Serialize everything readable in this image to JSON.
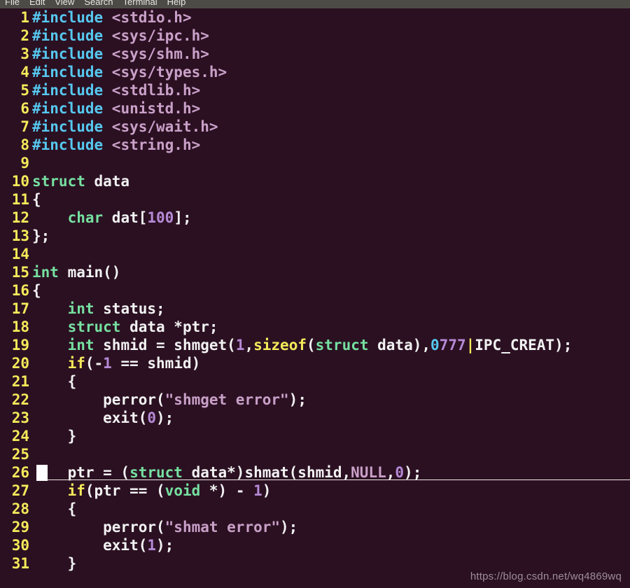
{
  "window": {
    "title": "Terminal",
    "background_color": "#2b1022",
    "menubar_color": "#4d4b45"
  },
  "menubar": {
    "items": [
      {
        "label": "File"
      },
      {
        "label": "Edit"
      },
      {
        "label": "View"
      },
      {
        "label": "Search"
      },
      {
        "label": "Terminal"
      },
      {
        "label": "Help"
      }
    ]
  },
  "editor": {
    "cursor_line": 26,
    "colors": {
      "line_number": "#f5ea5a",
      "preprocessor": "#56c8ef",
      "header": "#c9a0c8",
      "type_keyword": "#76e0a0",
      "keyword": "#f5ea5a",
      "number": "#b58ad6",
      "string": "#c9a0c8",
      "plain": "#f2f2f2",
      "cursor": "#ffffff"
    },
    "lines": [
      {
        "n": "1",
        "tokens": [
          {
            "t": "#include ",
            "c": "pre"
          },
          {
            "t": "<stdio.h>",
            "c": "header"
          }
        ]
      },
      {
        "n": "2",
        "tokens": [
          {
            "t": "#include ",
            "c": "pre"
          },
          {
            "t": "<sys/ipc.h>",
            "c": "header"
          }
        ]
      },
      {
        "n": "3",
        "tokens": [
          {
            "t": "#include ",
            "c": "pre"
          },
          {
            "t": "<sys/shm.h>",
            "c": "header"
          }
        ]
      },
      {
        "n": "4",
        "tokens": [
          {
            "t": "#include ",
            "c": "pre"
          },
          {
            "t": "<sys/types.h>",
            "c": "header"
          }
        ]
      },
      {
        "n": "5",
        "tokens": [
          {
            "t": "#include ",
            "c": "pre"
          },
          {
            "t": "<stdlib.h>",
            "c": "header"
          }
        ]
      },
      {
        "n": "6",
        "tokens": [
          {
            "t": "#include ",
            "c": "pre"
          },
          {
            "t": "<unistd.h>",
            "c": "header"
          }
        ]
      },
      {
        "n": "7",
        "tokens": [
          {
            "t": "#include ",
            "c": "pre"
          },
          {
            "t": "<sys/wait.h>",
            "c": "header"
          }
        ]
      },
      {
        "n": "8",
        "tokens": [
          {
            "t": "#include ",
            "c": "pre"
          },
          {
            "t": "<string.h>",
            "c": "header"
          }
        ]
      },
      {
        "n": "9",
        "tokens": []
      },
      {
        "n": "10",
        "tokens": [
          {
            "t": "struct",
            "c": "type"
          },
          {
            "t": " data",
            "c": "plain"
          }
        ]
      },
      {
        "n": "11",
        "tokens": [
          {
            "t": "{",
            "c": "plain"
          }
        ]
      },
      {
        "n": "12",
        "tokens": [
          {
            "t": "    ",
            "c": "plain"
          },
          {
            "t": "char",
            "c": "type"
          },
          {
            "t": " dat[",
            "c": "plain"
          },
          {
            "t": "100",
            "c": "num"
          },
          {
            "t": "];",
            "c": "plain"
          }
        ]
      },
      {
        "n": "13",
        "tokens": [
          {
            "t": "};",
            "c": "plain"
          }
        ]
      },
      {
        "n": "14",
        "tokens": []
      },
      {
        "n": "15",
        "tokens": [
          {
            "t": "int",
            "c": "type"
          },
          {
            "t": " main()",
            "c": "plain"
          }
        ]
      },
      {
        "n": "16",
        "tokens": [
          {
            "t": "{",
            "c": "plain"
          }
        ]
      },
      {
        "n": "17",
        "tokens": [
          {
            "t": "    ",
            "c": "plain"
          },
          {
            "t": "int",
            "c": "type"
          },
          {
            "t": " status;",
            "c": "plain"
          }
        ]
      },
      {
        "n": "18",
        "tokens": [
          {
            "t": "    ",
            "c": "plain"
          },
          {
            "t": "struct",
            "c": "type"
          },
          {
            "t": " data *ptr;",
            "c": "plain"
          }
        ]
      },
      {
        "n": "19",
        "tokens": [
          {
            "t": "    ",
            "c": "plain"
          },
          {
            "t": "int",
            "c": "type"
          },
          {
            "t": " shmid = shmget(",
            "c": "plain"
          },
          {
            "t": "1",
            "c": "num"
          },
          {
            "t": ",",
            "c": "plain"
          },
          {
            "t": "sizeof",
            "c": "kw"
          },
          {
            "t": "(",
            "c": "plain"
          },
          {
            "t": "struct",
            "c": "type"
          },
          {
            "t": " data),",
            "c": "plain"
          },
          {
            "t": "0",
            "c": "num2"
          },
          {
            "t": "777",
            "c": "num"
          },
          {
            "t": "|",
            "c": "kw"
          },
          {
            "t": "IPC_CREAT);",
            "c": "plain"
          }
        ]
      },
      {
        "n": "20",
        "tokens": [
          {
            "t": "    ",
            "c": "plain"
          },
          {
            "t": "if",
            "c": "kw"
          },
          {
            "t": "(-",
            "c": "plain"
          },
          {
            "t": "1",
            "c": "num"
          },
          {
            "t": " == shmid)",
            "c": "plain"
          }
        ]
      },
      {
        "n": "21",
        "tokens": [
          {
            "t": "    {",
            "c": "plain"
          }
        ]
      },
      {
        "n": "22",
        "tokens": [
          {
            "t": "        perror(",
            "c": "plain"
          },
          {
            "t": "\"shmget error\"",
            "c": "str"
          },
          {
            "t": ");",
            "c": "plain"
          }
        ]
      },
      {
        "n": "23",
        "tokens": [
          {
            "t": "        exit(",
            "c": "plain"
          },
          {
            "t": "0",
            "c": "num"
          },
          {
            "t": ");",
            "c": "plain"
          }
        ]
      },
      {
        "n": "24",
        "tokens": [
          {
            "t": "    }",
            "c": "plain"
          }
        ]
      },
      {
        "n": "25",
        "tokens": []
      },
      {
        "n": "26",
        "tokens": [
          {
            "t": "    ptr = (",
            "c": "plain"
          },
          {
            "t": "struct",
            "c": "type"
          },
          {
            "t": " data*)shmat(shmid,",
            "c": "plain"
          },
          {
            "t": "NULL",
            "c": "const"
          },
          {
            "t": ",",
            "c": "plain"
          },
          {
            "t": "0",
            "c": "num"
          },
          {
            "t": ");",
            "c": "plain"
          }
        ],
        "current": true
      },
      {
        "n": "27",
        "tokens": [
          {
            "t": "    ",
            "c": "plain"
          },
          {
            "t": "if",
            "c": "kw"
          },
          {
            "t": "(ptr == (",
            "c": "plain"
          },
          {
            "t": "void",
            "c": "type"
          },
          {
            "t": " *) - ",
            "c": "plain"
          },
          {
            "t": "1",
            "c": "num"
          },
          {
            "t": ")",
            "c": "plain"
          }
        ]
      },
      {
        "n": "28",
        "tokens": [
          {
            "t": "    {",
            "c": "plain"
          }
        ]
      },
      {
        "n": "29",
        "tokens": [
          {
            "t": "        perror(",
            "c": "plain"
          },
          {
            "t": "\"shmat error\"",
            "c": "str"
          },
          {
            "t": ");",
            "c": "plain"
          }
        ]
      },
      {
        "n": "30",
        "tokens": [
          {
            "t": "        exit(",
            "c": "plain"
          },
          {
            "t": "1",
            "c": "num"
          },
          {
            "t": ");",
            "c": "plain"
          }
        ]
      },
      {
        "n": "31",
        "tokens": [
          {
            "t": "    }",
            "c": "plain"
          }
        ]
      }
    ]
  },
  "watermark": {
    "text": "https://blog.csdn.net/wq4869wq"
  }
}
